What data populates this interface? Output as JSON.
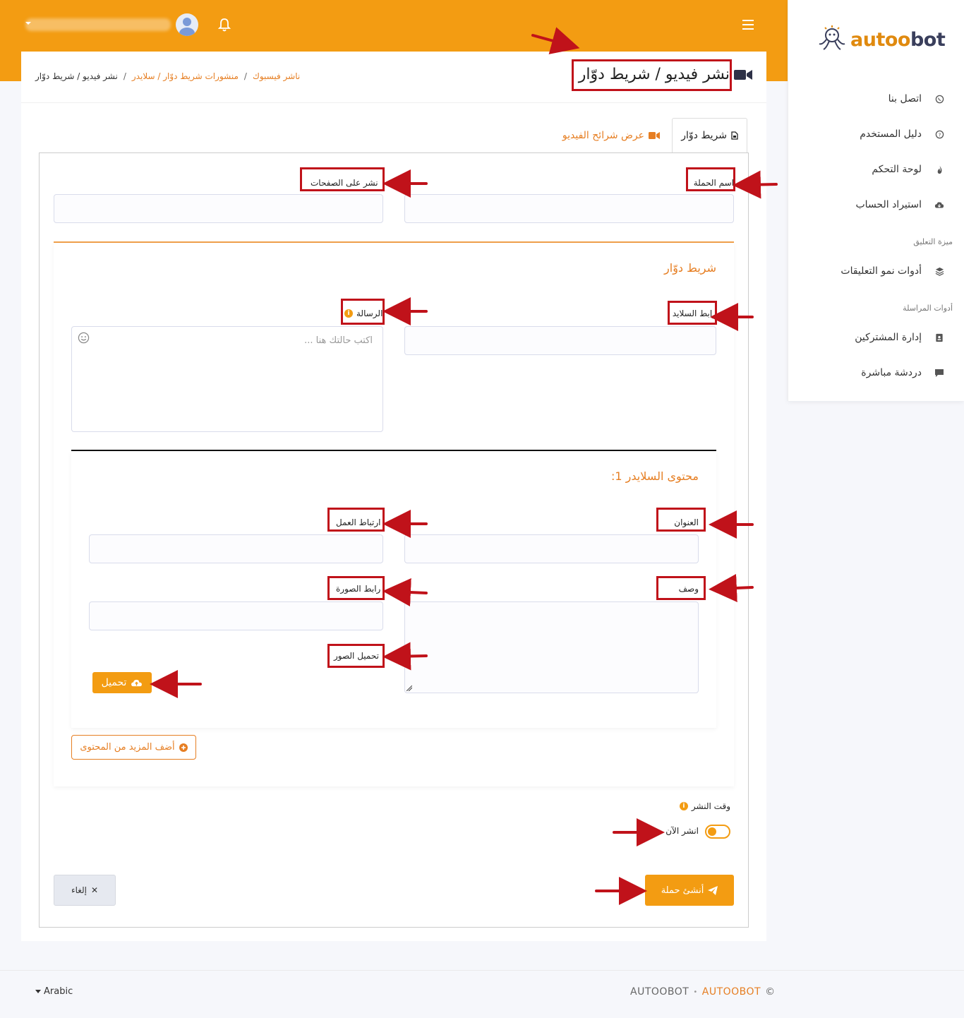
{
  "brand": {
    "logo_text": "autoobot"
  },
  "header": {
    "username": "",
    "accent": "#f39c12"
  },
  "sidebar": {
    "items": [
      {
        "label": "اتصل بنا",
        "icon": "whatsapp-icon"
      },
      {
        "label": "دليل المستخدم",
        "icon": "question-circle-icon"
      },
      {
        "label": "لوحة التحكم",
        "icon": "fire-icon"
      },
      {
        "label": "استيراد الحساب",
        "icon": "cloud-download-icon"
      },
      {
        "label": "أدوات نمو التعليقات",
        "icon": "layers-icon"
      },
      {
        "label": "إدارة المشتركين",
        "icon": "address-book-icon"
      },
      {
        "label": "دردشة مباشرة",
        "icon": "chat-icon"
      }
    ],
    "headings": [
      "ميزة التعليق",
      "أدوات المراسلة"
    ]
  },
  "page": {
    "title": "نشر فيديو / شريط دوّار",
    "breadcrumb": [
      "ناشر فيسبوك",
      "منشورات شريط دوّار / سلايدر",
      "نشر فيديو / شريط دوّار"
    ],
    "breadcrumb_sep": "/"
  },
  "tabs": {
    "active": "شريط دوّار",
    "other": "عرض شرائح الفيديو"
  },
  "form": {
    "campaign_name_label": "اسم الحملة",
    "pages_label": "نشر على الصفحات",
    "carousel_title": "شريط دوّار",
    "slide_link_label": "رابط السلايد",
    "message_label": "الرسالة",
    "message_placeholder": "اكتب حالتك هنا ...",
    "slider_content_title": "محتوى السلايدر 1:",
    "title_label": "العنوان",
    "action_link_label": "ارتباط العمل",
    "description_label": "وصف",
    "image_link_label": "رابط الصورة",
    "upload_images_label": "تحميل الصور",
    "upload_button": "تحميل",
    "add_more_button": "أضف المزيد من المحتوى",
    "post_time_label": "وقت النشر",
    "post_now_label": "انشر الآن",
    "post_now": false,
    "create_button": "أنشئ حملة",
    "cancel_button": "إلغاء"
  },
  "footer": {
    "language": "Arabic",
    "copyright": "©",
    "brand1": "AUTOOBOT",
    "dot": "•",
    "brand2": "AUTOOBOT"
  }
}
